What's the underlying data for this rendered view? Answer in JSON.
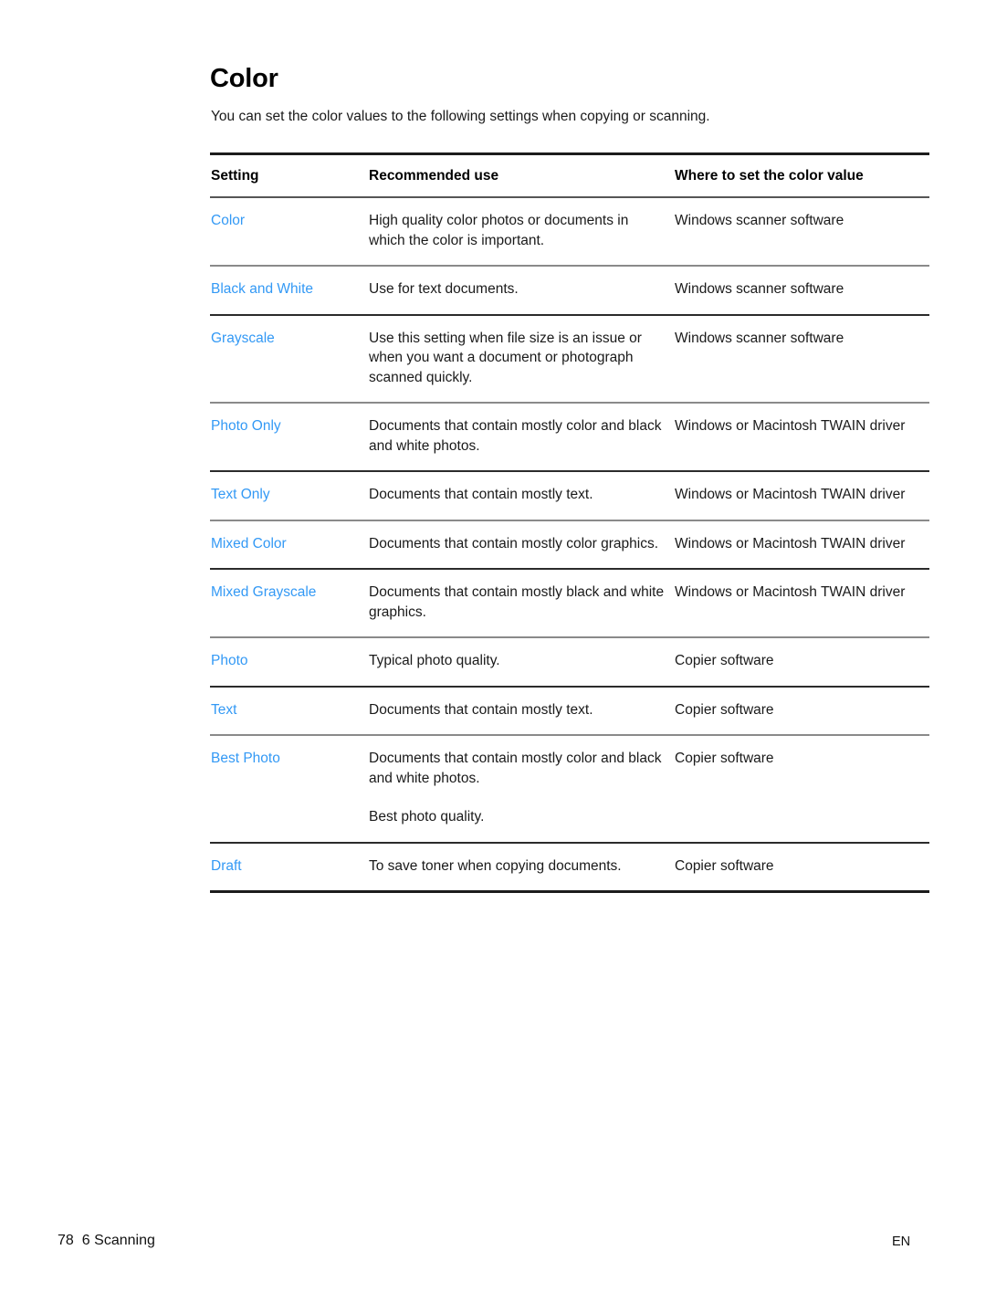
{
  "document": {
    "heading": "Color",
    "intro": "You can set the color values to the following settings when copying or scanning.",
    "accent_color": "#3399f5",
    "text_color": "#1a1a1a"
  },
  "table": {
    "headers": {
      "setting": "Setting",
      "recommended_use": "Recommended use",
      "where_to_set": "Where to set the color value"
    },
    "rows": [
      {
        "setting": "Color",
        "use": "High quality color photos or documents in which the color is important.",
        "use_extra": "",
        "where": "Windows scanner software"
      },
      {
        "setting": "Black and White",
        "use": "Use for text documents.",
        "use_extra": "",
        "where": "Windows scanner software"
      },
      {
        "setting": "Grayscale",
        "use": "Use this setting when file size is an issue or when you want a document or photograph scanned quickly.",
        "use_extra": "",
        "where": "Windows scanner software"
      },
      {
        "setting": "Photo Only",
        "use": "Documents that contain mostly color and black and white photos.",
        "use_extra": "",
        "where": "Windows or Macintosh TWAIN driver"
      },
      {
        "setting": "Text Only",
        "use": "Documents that contain mostly text.",
        "use_extra": "",
        "where": "Windows or Macintosh TWAIN driver"
      },
      {
        "setting": "Mixed Color",
        "use": "Documents that contain mostly color graphics.",
        "use_extra": "",
        "where": "Windows or Macintosh TWAIN driver"
      },
      {
        "setting": "Mixed Grayscale",
        "use": "Documents that contain mostly black and white graphics.",
        "use_extra": "",
        "where": "Windows or Macintosh TWAIN driver"
      },
      {
        "setting": "Photo",
        "use": "Typical photo quality.",
        "use_extra": "",
        "where": "Copier software"
      },
      {
        "setting": "Text",
        "use": "Documents that contain mostly text.",
        "use_extra": "",
        "where": "Copier software"
      },
      {
        "setting": "Best Photo",
        "use": "Documents that contain mostly color and black and white photos.",
        "use_extra": "Best photo quality.",
        "where": "Copier software"
      },
      {
        "setting": "Draft",
        "use": "To save toner when copying documents.",
        "use_extra": "",
        "where": "Copier software"
      }
    ]
  },
  "footer": {
    "page_number": "78",
    "chapter": "6 Scanning",
    "language": "EN"
  }
}
